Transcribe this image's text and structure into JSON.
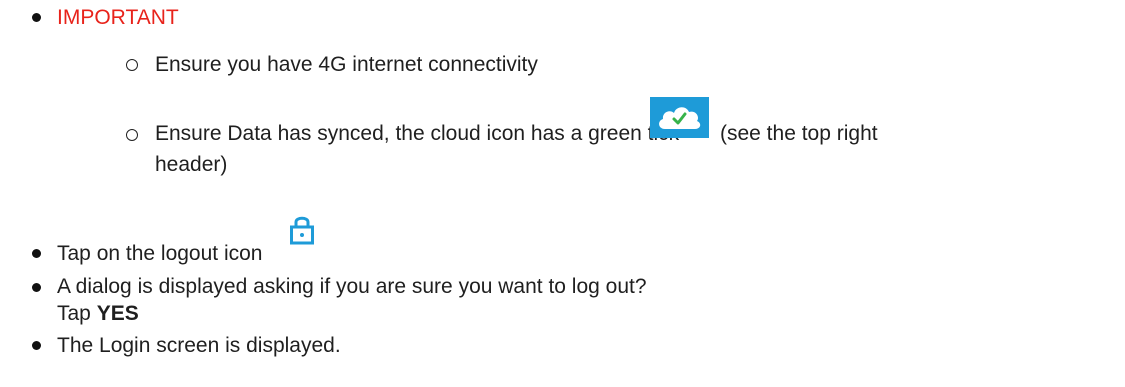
{
  "important": {
    "label": "IMPORTANT",
    "color": "#e8231b",
    "sub_items": [
      {
        "text": "Ensure you have 4G internet connectivity"
      },
      {
        "text_before_icon": "Ensure Data has synced, the cloud icon has a green tick",
        "icon": "cloud-sync-check-icon",
        "text_after_icon": "(see the top right",
        "text_continued": "header)"
      }
    ]
  },
  "steps": [
    {
      "text": "Tap on the logout icon",
      "icon": "lock-logout-icon"
    },
    {
      "text": "A dialog is displayed asking if you are sure you want to log out?",
      "action_prefix": "Tap",
      "action_bold": "YES"
    },
    {
      "text": "The Login screen is displayed."
    }
  ],
  "colors": {
    "icon_blue": "#1e9bd8",
    "tick_green": "#36b34a",
    "text": "#1f1f1f"
  }
}
